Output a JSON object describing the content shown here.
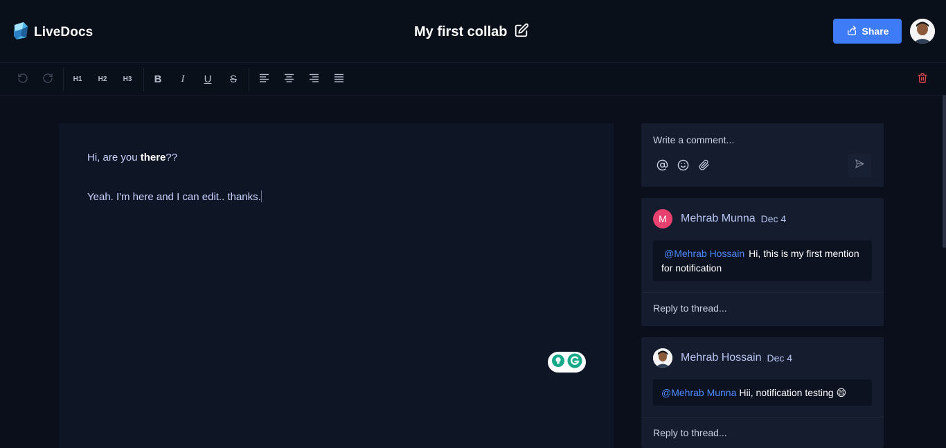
{
  "app": {
    "name": "LiveDocs"
  },
  "document": {
    "title": "My first collab"
  },
  "header": {
    "share_label": "Share"
  },
  "toolbar": {
    "h1": "H1",
    "h2": "H2",
    "h3": "H3",
    "bold": "B",
    "italic": "I",
    "underline": "U",
    "strike": "S"
  },
  "editor": {
    "line1_pre": "Hi, are you ",
    "line1_bold": "there",
    "line1_post": "??",
    "line2": "Yeah. I'm here and I can edit.. thanks."
  },
  "composer": {
    "placeholder": "Write a comment..."
  },
  "threads": [
    {
      "author": "Mehrab Munna",
      "initial": "M",
      "avatar_color": "#e8416f",
      "date": "Dec 4",
      "mention": "@Mehrab Hossain",
      "text": "Hi, this is my first mention for notification",
      "reply_placeholder": "Reply to thread..."
    },
    {
      "author": "Mehrab Hossain",
      "date": "Dec 4",
      "mention": "@Mehrab Munna",
      "text": "Hii, notification testing 😄",
      "reply_placeholder": "Reply to thread..."
    }
  ],
  "colors": {
    "accent": "#3d7bf7",
    "mention": "#4d8bff",
    "danger": "#e5484d"
  },
  "icons": [
    "logo-icon",
    "edit-icon",
    "share-icon",
    "undo-icon",
    "redo-icon",
    "align-left-icon",
    "align-center-icon",
    "align-right-icon",
    "align-justify-icon",
    "trash-icon",
    "at-icon",
    "emoji-icon",
    "attach-icon",
    "send-icon"
  ]
}
